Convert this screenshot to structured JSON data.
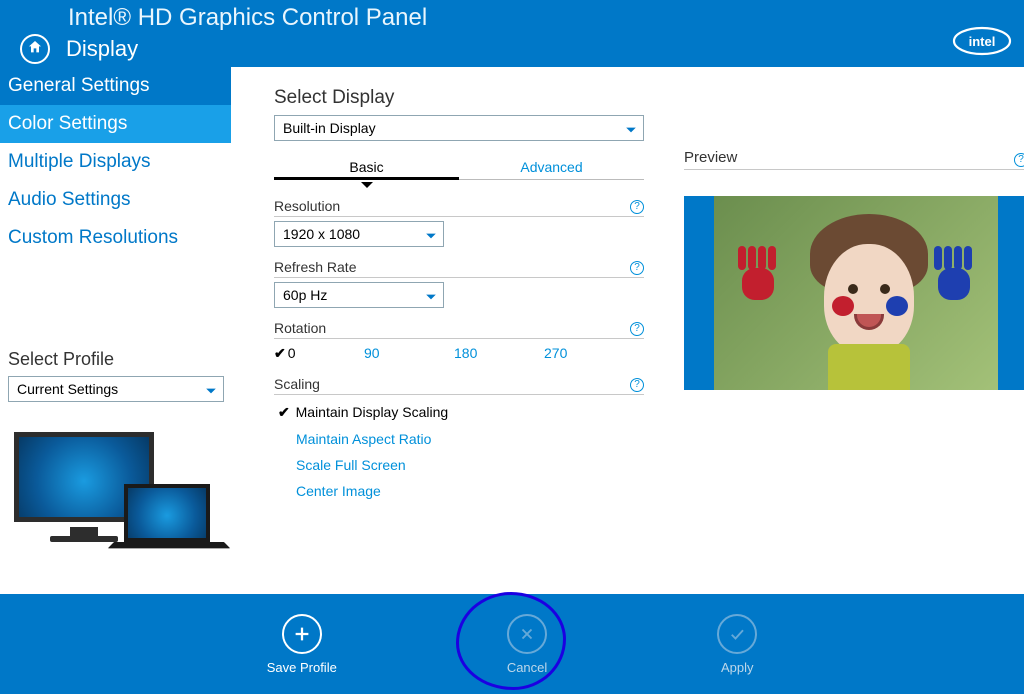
{
  "header": {
    "title": "Intel® HD Graphics Control Panel",
    "section": "Display"
  },
  "sidebar": {
    "items": [
      {
        "label": "General Settings"
      },
      {
        "label": "Color Settings"
      },
      {
        "label": "Multiple Displays"
      },
      {
        "label": "Audio Settings"
      },
      {
        "label": "Custom Resolutions"
      }
    ],
    "select_profile_label": "Select Profile",
    "profile_value": "Current Settings"
  },
  "display": {
    "select_display_label": "Select Display",
    "select_display_value": "Built-in Display",
    "tabs": {
      "basic": "Basic",
      "advanced": "Advanced"
    },
    "resolution_label": "Resolution",
    "resolution_value": "1920 x 1080",
    "refresh_label": "Refresh Rate",
    "refresh_value": "60p Hz",
    "rotation_label": "Rotation",
    "rotation_options": [
      "0",
      "90",
      "180",
      "270"
    ],
    "scaling_label": "Scaling",
    "scaling_options": [
      "Maintain Display Scaling",
      "Maintain Aspect Ratio",
      "Scale Full Screen",
      "Center Image"
    ]
  },
  "preview": {
    "label": "Preview"
  },
  "footer": {
    "save": "Save Profile",
    "cancel": "Cancel",
    "apply": "Apply"
  }
}
